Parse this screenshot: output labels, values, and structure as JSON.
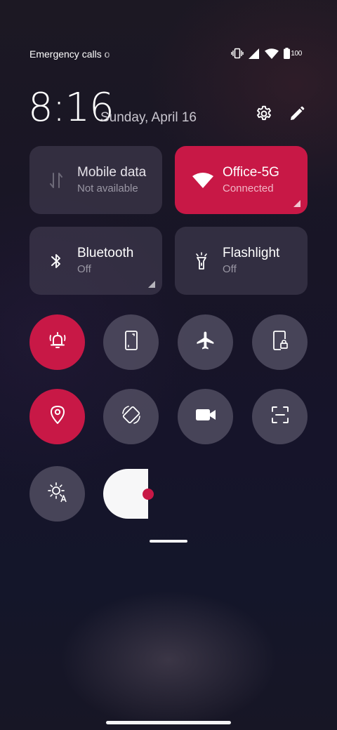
{
  "status_bar": {
    "carrier_text": "Emergency calls o",
    "battery_level": "100",
    "icons": [
      "vibrate-icon",
      "signal-icon",
      "wifi-icon",
      "battery-icon"
    ]
  },
  "header": {
    "time": "8:16",
    "date": "Sunday, April 16",
    "settings_icon": "gear-icon",
    "edit_icon": "pencil-icon"
  },
  "tiles": [
    {
      "title": "Mobile data",
      "subtitle": "Not available",
      "icon": "mobile-data-icon",
      "active": false
    },
    {
      "title": "Office-5G",
      "subtitle": "Connected",
      "icon": "wifi-icon",
      "active": true
    },
    {
      "title": "Bluetooth",
      "subtitle": "Off",
      "icon": "bluetooth-icon",
      "active": false
    },
    {
      "title": "Flashlight",
      "subtitle": "Off",
      "icon": "flashlight-icon",
      "active": false
    }
  ],
  "round_toggles": [
    {
      "icon": "alarm-bell-icon",
      "active": true
    },
    {
      "icon": "phone-portrait-icon",
      "active": false
    },
    {
      "icon": "airplane-icon",
      "active": false
    },
    {
      "icon": "screen-lock-icon",
      "active": false
    },
    {
      "icon": "location-pin-icon",
      "active": true
    },
    {
      "icon": "auto-rotate-icon",
      "active": false
    },
    {
      "icon": "video-camera-icon",
      "active": false
    },
    {
      "icon": "screenshot-scan-icon",
      "active": false
    }
  ],
  "brightness": {
    "icon": "auto-brightness-icon",
    "level": 0.15
  },
  "colors": {
    "accent": "#c81846",
    "tile_bg": "#48445a",
    "background": "#181526"
  }
}
